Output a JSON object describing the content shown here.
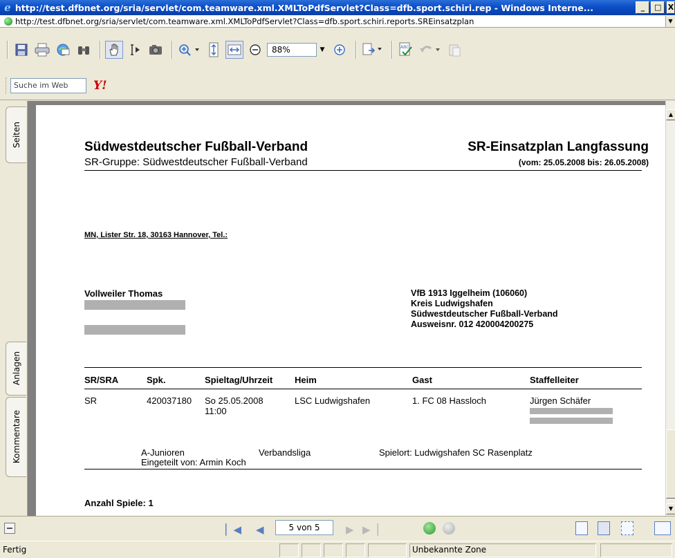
{
  "window": {
    "title": "http://test.dfbnet.org/sria/servlet/com.teamware.xml.XMLToPdfServlet?Class=dfb.sport.schiri.rep - Windows Interne...",
    "minimize": "_",
    "maximize": "□",
    "close": "X"
  },
  "address": {
    "url": "http://test.dfbnet.org/sria/servlet/com.teamware.xml.XMLToPdfServlet?Class=dfb.sport.schiri.reports.SREinsatzplan"
  },
  "toolbar": {
    "zoom_value": "88%",
    "icons": [
      "save-icon",
      "print-icon",
      "email-icon",
      "find-icon",
      "hand-tool-icon",
      "select-text-icon",
      "snapshot-icon",
      "zoom-in-icon",
      "fit-page-icon",
      "fit-width-icon",
      "zoom-out-icon",
      "zoom-plus-icon",
      "page-options-icon",
      "spell-check-icon",
      "undo-icon",
      "paste-icon"
    ]
  },
  "search": {
    "placeholder": "Suche im Web",
    "yahoo_label": "Y!"
  },
  "side_tabs": [
    "Seiten",
    "Anlagen",
    "Kommentare"
  ],
  "document": {
    "org_title": "Südwestdeutscher Fußball-Verband",
    "org_subtitle": "SR-Gruppe: Südwestdeutscher Fußball-Verband",
    "doc_title": "SR-Einsatzplan Langfassung",
    "doc_range": "(vom: 25.05.2008 bis: 26.05.2008)",
    "address_line": "MN, Lister Str. 18, 30163 Hannover, Tel.:",
    "referee_name": "Vollweiler Thomas",
    "club_lines": [
      "VfB 1913 Iggelheim (106060)",
      "Kreis Ludwigshafen",
      "Südwestdeutscher Fußball-Verband",
      "Ausweisnr. 012 420004200275"
    ],
    "table_headers": [
      "SR/SRA",
      "Spk.",
      "Spieltag/Uhrzeit",
      "Heim",
      "Gast",
      "Staffelleiter"
    ],
    "row": {
      "role": "SR",
      "spk": "420037180",
      "date": "So 25.05.2008",
      "time": "11:00",
      "home": "LSC Ludwigshafen",
      "guest": "1. FC 08 Hassloch",
      "staffelleiter": "Jürgen Schäfer"
    },
    "footer": {
      "age_group": "A-Junioren",
      "assigned_by": "Eingeteilt von: Armin Koch",
      "league": "Verbandsliga",
      "venue": "Spielort: Ludwigshafen SC Rasenplatz"
    },
    "game_count": "Anzahl Spiele: 1"
  },
  "navigation": {
    "page_indicator": "5 von 5"
  },
  "status": {
    "text": "Fertig",
    "zone": "Unbekannte Zone"
  }
}
